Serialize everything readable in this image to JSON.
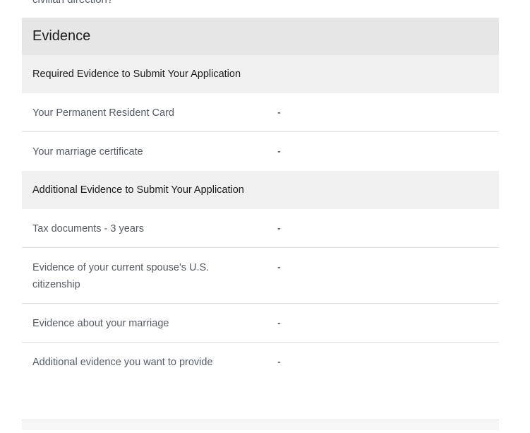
{
  "cutoff_text": "civilian direction?",
  "evidence": {
    "title": "Evidence",
    "required": {
      "heading": "Required Evidence to Submit Your Application",
      "rows": [
        {
          "label": "Your Permanent Resident Card",
          "value": "-"
        },
        {
          "label": "Your marriage certificate",
          "value": "-"
        }
      ]
    },
    "additional": {
      "heading": "Additional Evidence to Submit Your Application",
      "rows": [
        {
          "label": "Tax documents - 3 years",
          "value": "-"
        },
        {
          "label": "Evidence of your current spouse's U.S. citizenship",
          "value": "-"
        },
        {
          "label": "Evidence about your marriage",
          "value": "-"
        },
        {
          "label": "Additional evidence you want to provide",
          "value": "-"
        }
      ]
    }
  }
}
